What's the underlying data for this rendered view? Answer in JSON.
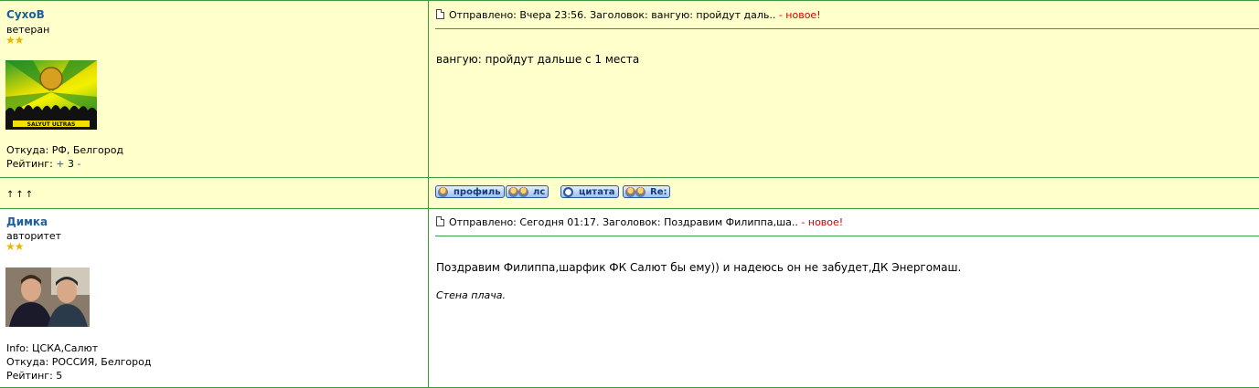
{
  "posts": [
    {
      "author": "СухоВ",
      "rank": "ветеран",
      "stars": "★★",
      "avatar_text": "SALYUT ULTRAS",
      "info_lines": [
        "Откуда: РФ, Белгород"
      ],
      "rating_label": "Рейтинг:",
      "rating_plus": "+",
      "rating_value": "3",
      "rating_minus": "-",
      "sent_label": "Отправлено: Вчера 23:56. Заголовок: вангую: пройдут даль..",
      "new_label": "- новое!",
      "message": "вангую: пройдут дальше с 1 места",
      "signature": ""
    },
    {
      "author": "Димка",
      "rank": "авторитет",
      "stars": "★★",
      "info_lines": [
        "Info: ЦСКА,Салют",
        "Откуда: РОССИЯ, Белгород"
      ],
      "rating_label": "Рейтинг:",
      "rating_value": "5",
      "sent_label": "Отправлено: Сегодня 01:17. Заголовок: Поздравим Филиппа,ша..",
      "new_label": "- новое!",
      "message": "Поздравим Филиппа,шарфик ФК Салют бы ему)) и надеюсь он не забудет,ДК Энергомаш.",
      "signature": "Стена плача."
    }
  ],
  "toolbar": {
    "up_arrows": "↑↑↑",
    "buttons": [
      "профиль",
      "лс",
      "цитата",
      "Re:"
    ]
  },
  "colors": {
    "border": "#3c9b3c",
    "author": "#1d5fa1",
    "new": "#d40000",
    "bg_yellow": "#ffffcc"
  }
}
